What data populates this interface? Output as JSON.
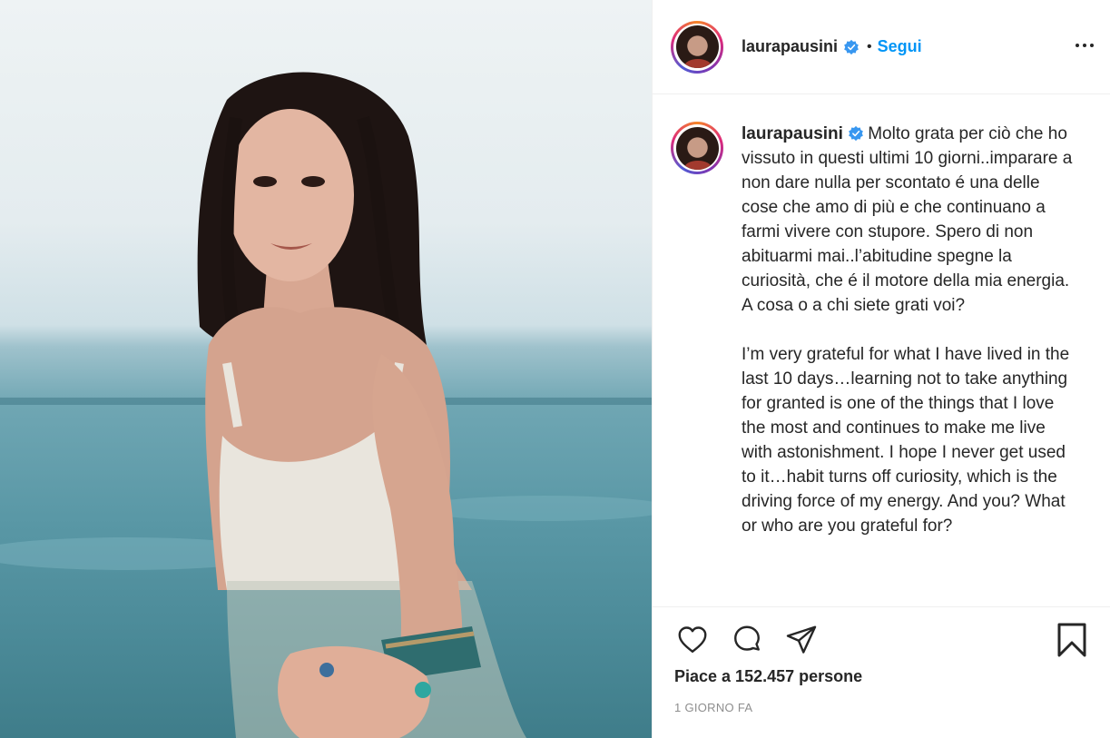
{
  "post": {
    "username": "laurapausini",
    "follow_label": "Segui",
    "more_icon": "more-options-icon",
    "caption_user": "laurapausini",
    "caption_text": "Molto grata per ciò che ho vissuto in questi ultimi 10 giorni..imparare a non dare nulla per scontato é una delle cose che amo di più e che continuano a farmi vivere con stupore. Spero di non abituarmi mai..l’abitudine spegne la curiosità, che é il motore della mia energia. A cosa o a chi siete grati voi?\n\nI’m very grateful for what I have lived in the last 10 days…learning not to take anything for granted is one of the things that I love the most and continues to make me live with astonishment. I hope I never get used to it…habit turns off curiosity, which is the driving force of my energy. And you? What or who are you grateful for?",
    "likes_text": "Piace a 152.457 persone",
    "timestamp": "1 GIORNO FA"
  },
  "icons": {
    "like": "heart-icon",
    "comment": "comment-icon",
    "share": "share-icon",
    "save": "bookmark-icon",
    "verified": "verified-badge-icon"
  },
  "colors": {
    "accent": "#0095f6",
    "verified": "#3897f0",
    "text": "#262626",
    "muted": "#8e8e8e",
    "border": "#efefef"
  }
}
